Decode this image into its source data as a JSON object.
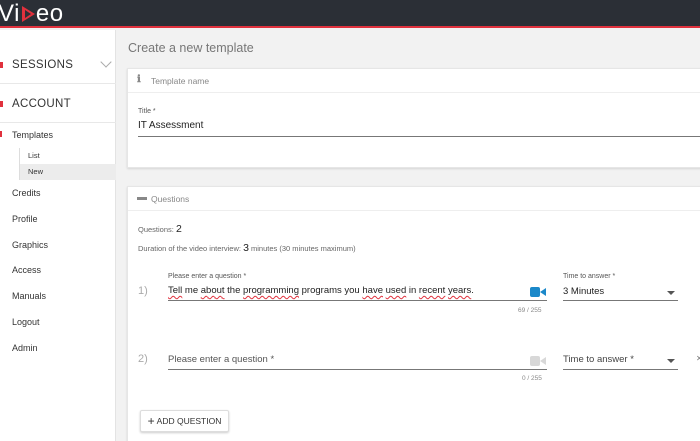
{
  "brand": {
    "logo_left": "Vi",
    "logo_right": "eo",
    "accent": "#e0313d",
    "topbar_bg": "#2b2f36"
  },
  "sidebar": {
    "sections": [
      {
        "label": "SESSIONS"
      },
      {
        "label": "ACCOUNT"
      }
    ],
    "templates_label": "Templates",
    "template_subitems": [
      "List",
      "New"
    ],
    "items": [
      "Credits",
      "Profile",
      "Graphics",
      "Access",
      "Manuals",
      "Logout",
      "Admin"
    ]
  },
  "main": {
    "page_title": "Create a new template",
    "template_card": {
      "header_icon": "info-icon",
      "header": "Template name",
      "title_label": "Title *",
      "title_value": "IT Assessment"
    },
    "questions_card": {
      "header_icon": "chat-icon",
      "header": "Questions",
      "questions_label": "Questions:",
      "questions_count": "2",
      "duration_label": "Duration of the video interview:",
      "duration_value": "3",
      "duration_suffix": "minutes (30 minutes maximum)",
      "questions": [
        {
          "number": "1)",
          "label": "Please enter a question *",
          "value": "Tell me about the programming programs you have used in recent years.",
          "counter": "69 / 255",
          "time_label": "Time to answer *",
          "time_value": "3 Minutes",
          "camera_color": "#1b88c9"
        },
        {
          "number": "2)",
          "placeholder": "Please enter a question *",
          "counter": "0 / 255",
          "time_placeholder": "Time to answer *",
          "camera_color": "#d8d8d8"
        }
      ],
      "add_button": "ADD QUESTION"
    }
  }
}
